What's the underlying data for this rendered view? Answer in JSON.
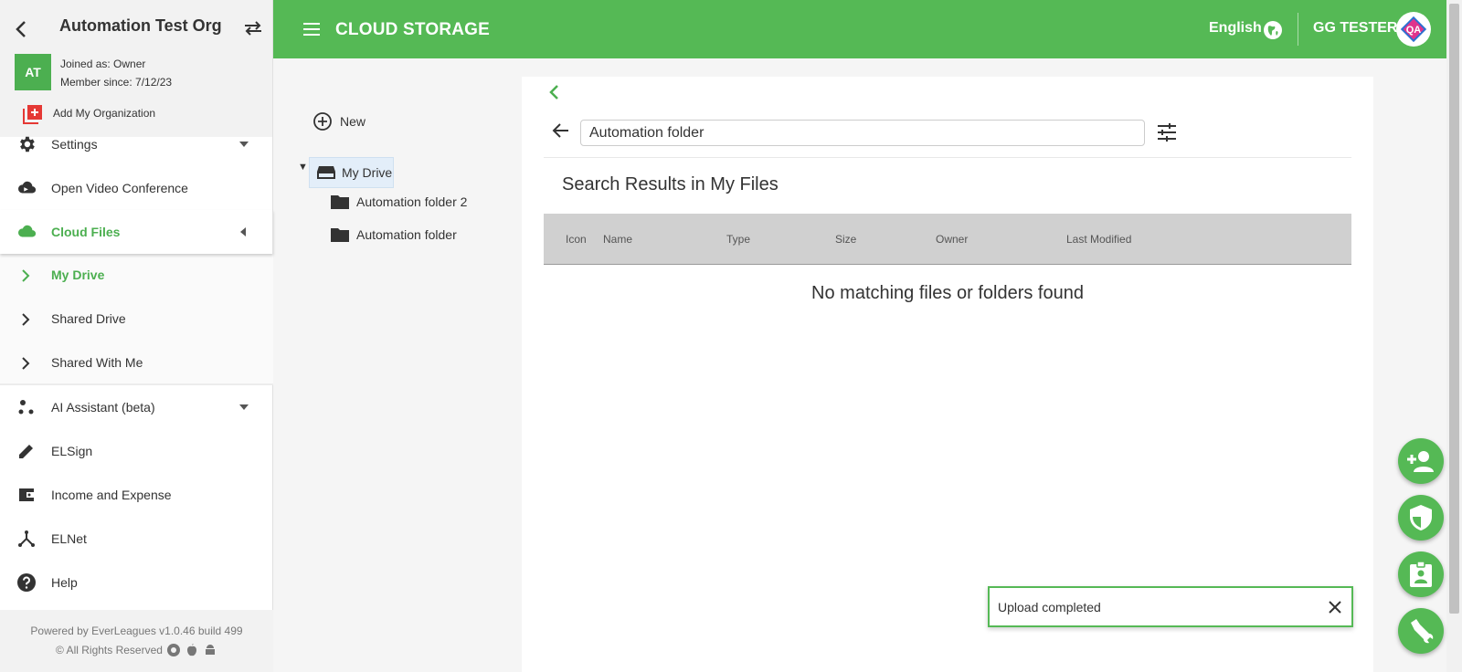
{
  "sidebar": {
    "org_name": "Automation Test Org",
    "avatar_initials": "AT",
    "joined_as": "Joined as: Owner",
    "member_since": "Member since: 7/12/23",
    "add_org_label": "Add My Organization",
    "items": [
      {
        "label": "Settings",
        "icon": "gear-icon"
      },
      {
        "label": "Open Video Conference",
        "icon": "cloud-video-icon"
      },
      {
        "label": "Cloud Files",
        "icon": "cloud-icon"
      },
      {
        "label": "AI Assistant (beta)",
        "icon": "ai-dots-icon"
      },
      {
        "label": "ELSign",
        "icon": "pencil-icon"
      },
      {
        "label": "Income and Expense",
        "icon": "wallet-icon"
      },
      {
        "label": "ELNet",
        "icon": "network-icon"
      },
      {
        "label": "Help",
        "icon": "help-icon"
      }
    ],
    "cloud_sub_items": [
      {
        "label": "My Drive"
      },
      {
        "label": "Shared Drive"
      },
      {
        "label": "Shared With Me"
      }
    ],
    "footer_powered": "Powered by EverLeagues v1.0.46 build 499",
    "footer_rights": "© All Rights Reserved"
  },
  "topbar": {
    "title": "CLOUD STORAGE",
    "language": "English",
    "user_name": "GG TESTER",
    "user_avatar_text": "QA"
  },
  "tree": {
    "new_label": "New",
    "root_label": "My Drive",
    "folders": [
      {
        "label": "Automation folder 2"
      },
      {
        "label": "Automation folder"
      }
    ]
  },
  "main": {
    "search_value": "Automation folder",
    "results_title": "Search Results in My Files",
    "columns": [
      "Icon",
      "Name",
      "Type",
      "Size",
      "Owner",
      "Last Modified"
    ],
    "empty_message": "No matching files or folders found"
  },
  "toast": {
    "message": "Upload completed"
  },
  "colors": {
    "brand_green": "#55b955",
    "accent_green": "#4caf50",
    "add_org_red": "#e53935"
  }
}
